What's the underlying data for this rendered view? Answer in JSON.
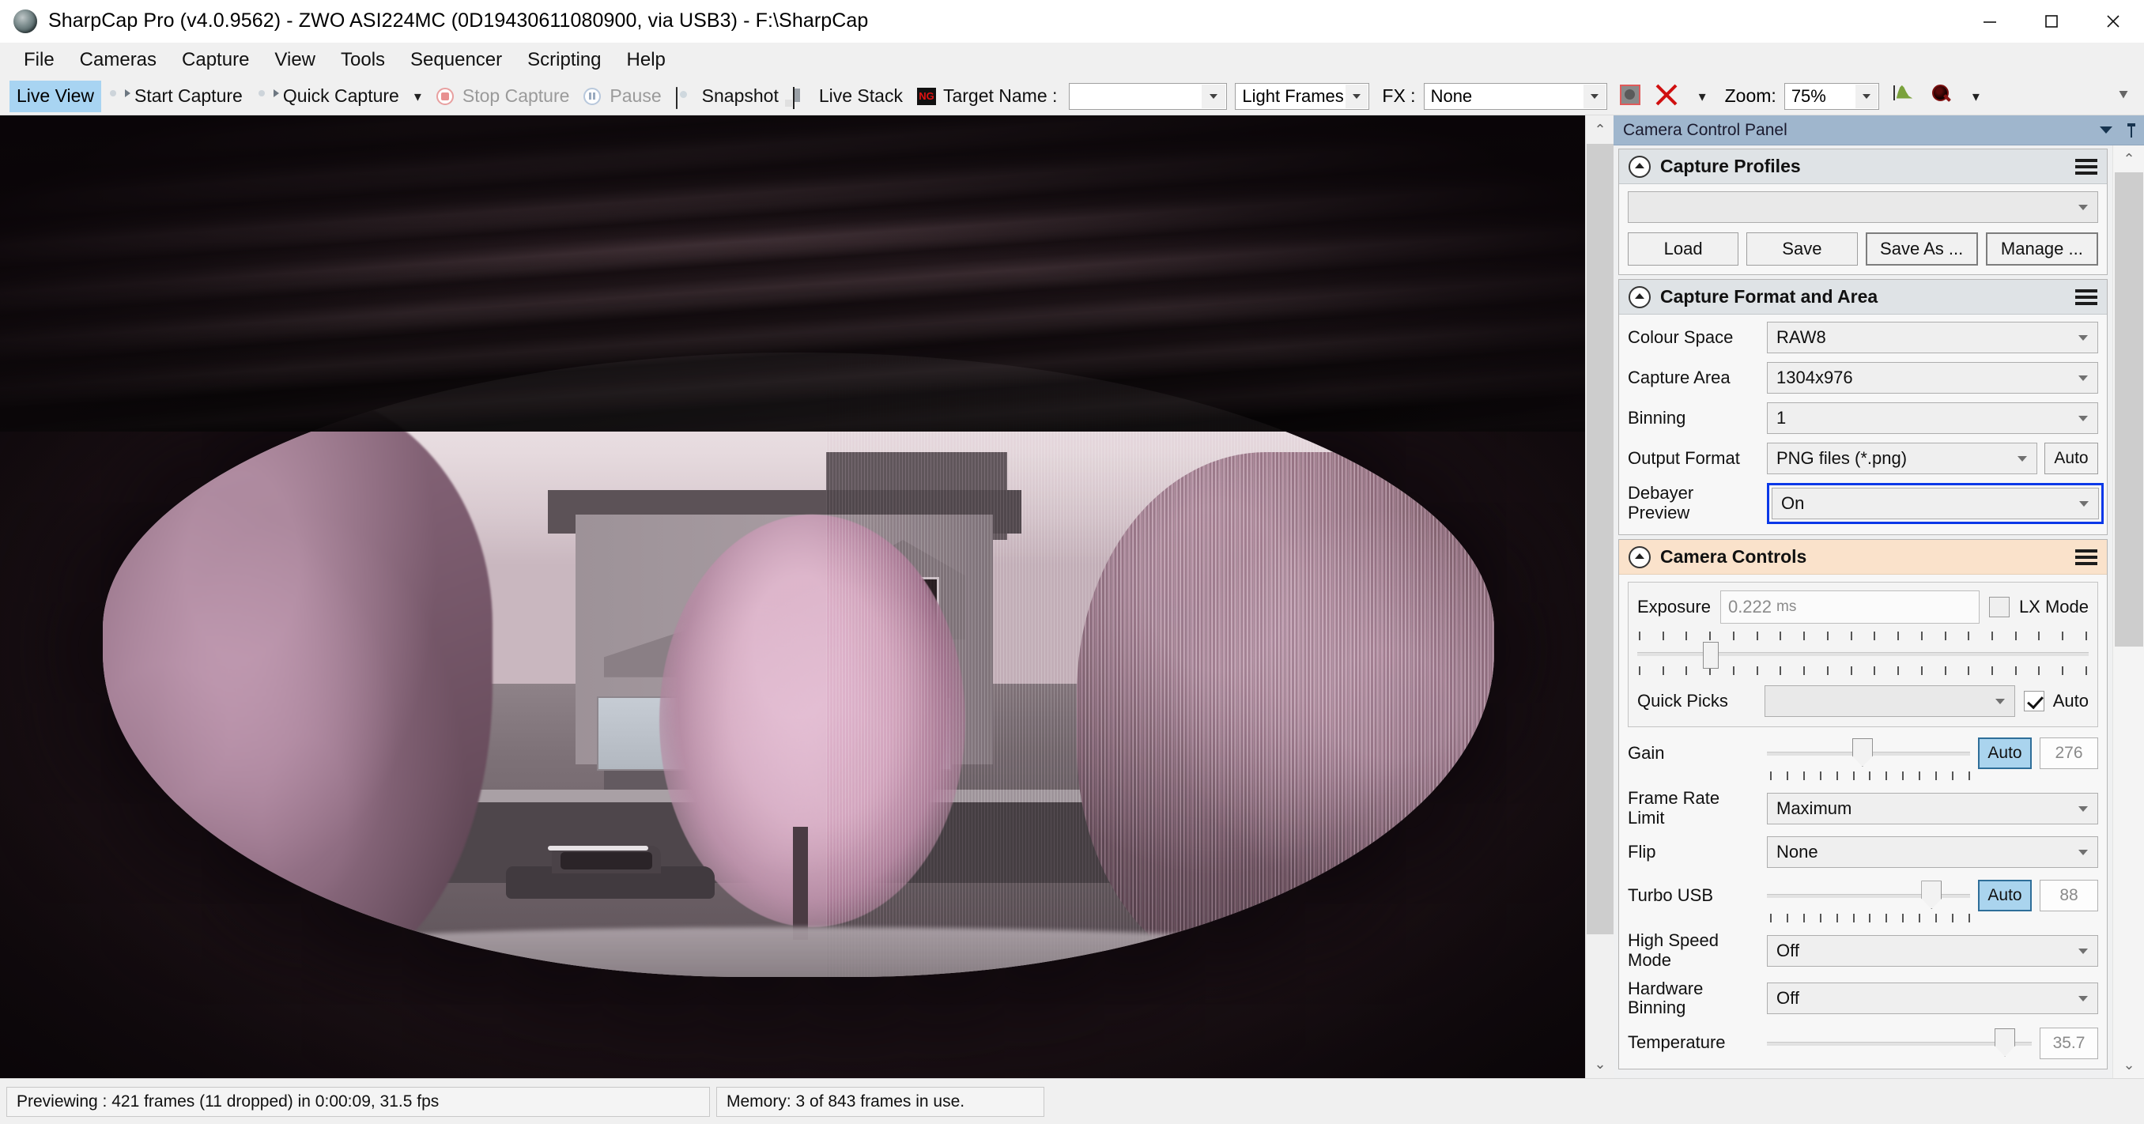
{
  "window": {
    "title": "SharpCap Pro (v4.0.9562) - ZWO ASI224MC (0D19430611080900, via USB3) - F:\\SharpCap",
    "minimize_label": "Minimize",
    "maximize_label": "Maximize",
    "close_label": "Close"
  },
  "menubar": {
    "items": [
      {
        "label": "File"
      },
      {
        "label": "Cameras"
      },
      {
        "label": "Capture"
      },
      {
        "label": "View"
      },
      {
        "label": "Tools"
      },
      {
        "label": "Sequencer"
      },
      {
        "label": "Scripting"
      },
      {
        "label": "Help"
      }
    ]
  },
  "toolbar": {
    "live_view": "Live View",
    "start_capture": "Start Capture",
    "quick_capture": "Quick Capture",
    "stop_capture": "Stop Capture",
    "pause": "Pause",
    "snapshot": "Snapshot",
    "live_stack": "Live Stack",
    "target_name_label": "Target Name :",
    "target_name_value": "",
    "frame_type_value": "Light Frames",
    "fx_label": "FX :",
    "fx_value": "None",
    "zoom_label": "Zoom:",
    "zoom_value": "75%"
  },
  "panel": {
    "title": "Camera Control Panel",
    "capture_profiles": {
      "heading": "Capture Profiles",
      "profile_value": "",
      "buttons": [
        "Load",
        "Save",
        "Save As ...",
        "Manage ..."
      ]
    },
    "capture_format": {
      "heading": "Capture Format and Area",
      "rows": [
        {
          "label": "Colour Space",
          "value": "RAW8"
        },
        {
          "label": "Capture Area",
          "value": "1304x976"
        },
        {
          "label": "Binning",
          "value": "1"
        }
      ],
      "output_format_label": "Output Format",
      "output_format_value": "PNG files (*.png)",
      "output_auto_label": "Auto",
      "debayer_label": "Debayer Preview",
      "debayer_value": "On",
      "focus_color": "#0a38e8"
    },
    "camera_controls": {
      "heading": "Camera Controls",
      "exposure_label": "Exposure",
      "exposure_value": "0.222",
      "exposure_unit": "ms",
      "lx_mode_label": "LX Mode",
      "lx_mode_checked": false,
      "quick_picks_label": "Quick Picks",
      "quick_picks_value": "",
      "quick_picks_auto_label": "Auto",
      "quick_picks_auto_checked": true,
      "gain_label": "Gain",
      "gain_auto_label": "Auto",
      "gain_value": "276",
      "frame_rate_label": "Frame Rate Limit",
      "frame_rate_value": "Maximum",
      "flip_label": "Flip",
      "flip_value": "None",
      "turbo_usb_label": "Turbo USB",
      "turbo_usb_auto_label": "Auto",
      "turbo_usb_value": "88",
      "high_speed_label": "High Speed Mode",
      "high_speed_value": "Off",
      "hardware_binning_label": "Hardware Binning",
      "hardware_binning_value": "Off",
      "temperature_label": "Temperature",
      "temperature_value": "35.7"
    }
  },
  "statusbar": {
    "preview_status": "Previewing : 421 frames (11 dropped) in 0:00:09, 31.5 fps",
    "memory_status": "Memory: 3 of 843 frames in use."
  },
  "preview": {
    "description": "Live camera preview: view through window blinds onto a suburban street with a house, pink infrared foliage and a parked car"
  }
}
